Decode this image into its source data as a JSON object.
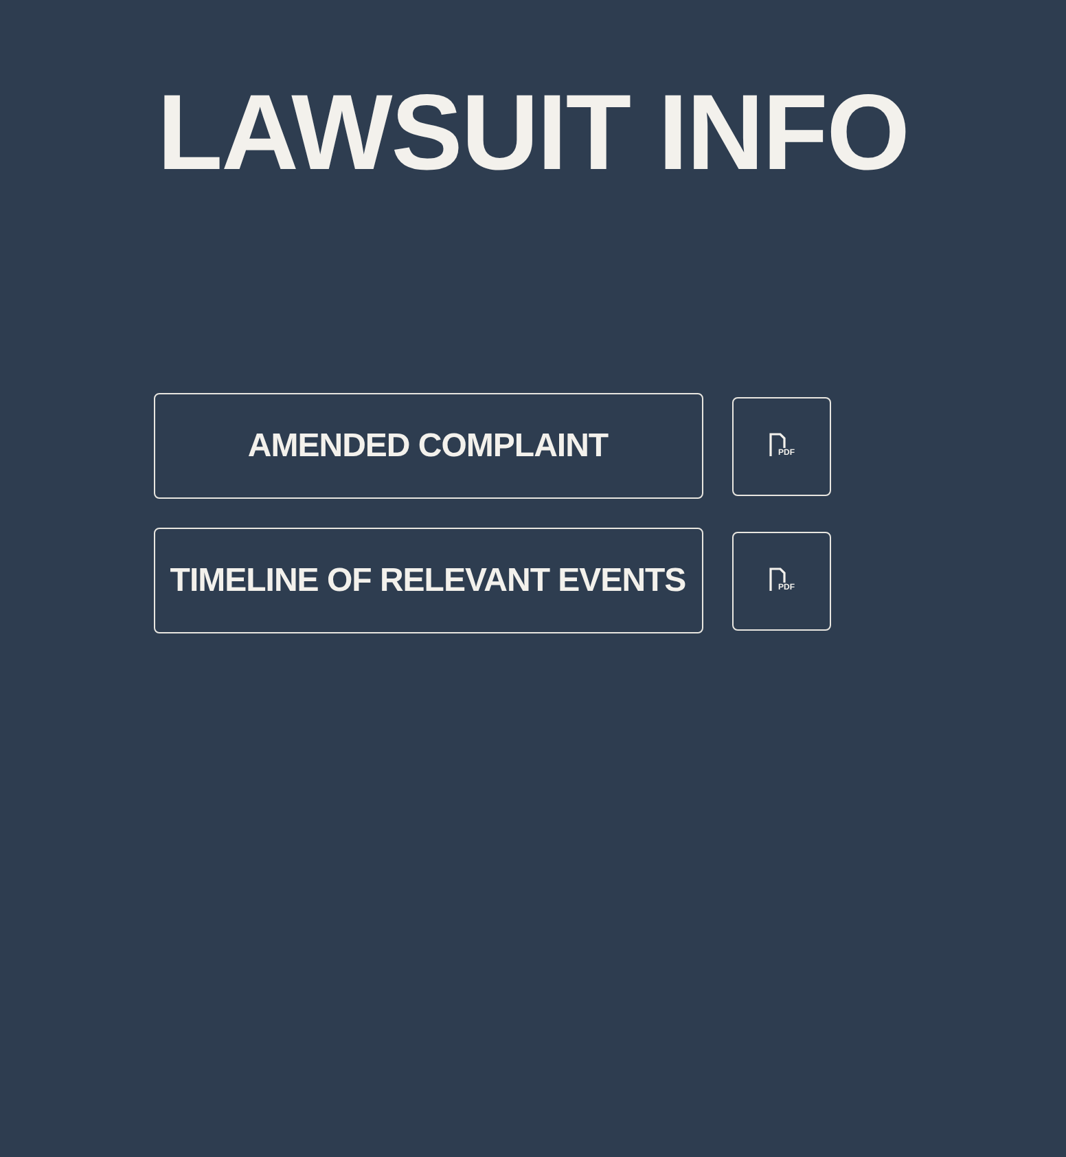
{
  "title": "LAWSUIT INFO",
  "documents": [
    {
      "label": "AMENDED COMPLAINT",
      "file_type": "PDF"
    },
    {
      "label": "TIMELINE OF RELEVANT EVENTS",
      "file_type": "PDF"
    }
  ]
}
